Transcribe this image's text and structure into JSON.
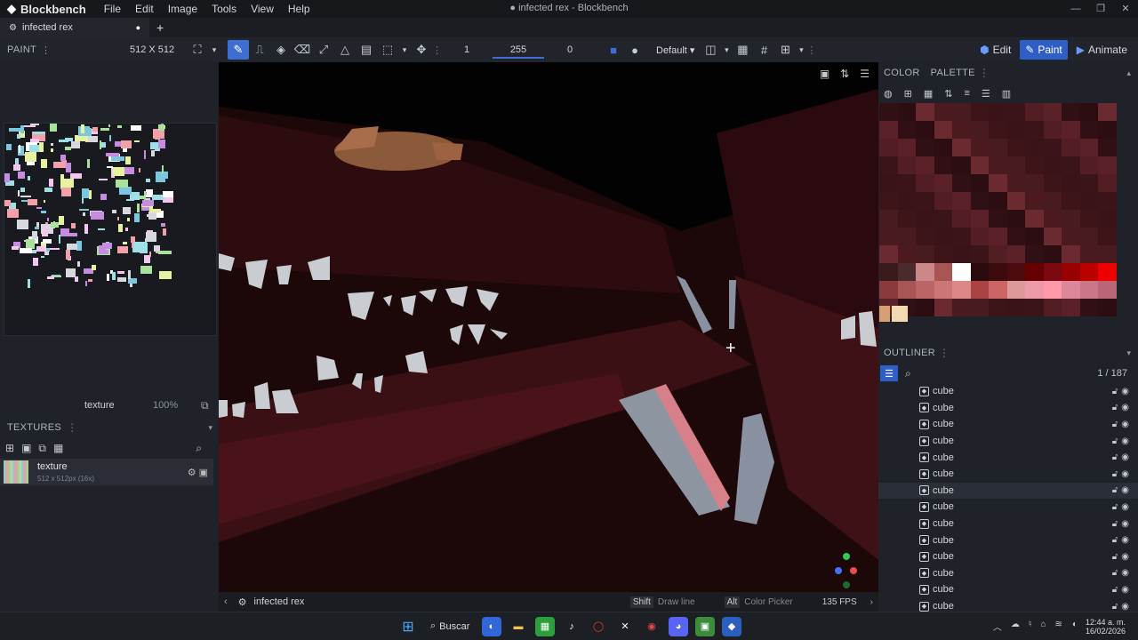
{
  "app": {
    "name": "Blockbench",
    "window_title": "● infected rex - Blockbench",
    "menu": [
      "File",
      "Edit",
      "Image",
      "Tools",
      "View",
      "Help"
    ]
  },
  "tabs": [
    {
      "label": "infected rex"
    }
  ],
  "toolbar": {
    "brush_size": "1",
    "opacity": "255",
    "softness": "0",
    "blend_mode": "Default"
  },
  "modes": {
    "edit": "Edit",
    "paint": "Paint",
    "animate": "Animate"
  },
  "left": {
    "panel_title": "PAINT",
    "resolution": "512 X 512",
    "texture_name": "texture",
    "zoom": "100%",
    "textures_title": "TEXTURES",
    "texture_item": {
      "name": "texture",
      "size": "512 x 512px (16x)"
    }
  },
  "viewport": {
    "model_name": "infected rex",
    "hint_shift_key": "Shift",
    "hint_shift_action": "Draw line",
    "hint_alt_key": "Alt",
    "hint_alt_action": "Color Picker",
    "fps": "135 FPS"
  },
  "right": {
    "color_tab": "COLOR",
    "palette_tab": "PALETTE",
    "outliner_title": "OUTLINER",
    "outliner_count": "1 / 187",
    "items": [
      "cube",
      "cube",
      "cube",
      "cube",
      "cube",
      "cube",
      "cube",
      "cube",
      "cube",
      "cube",
      "cube",
      "cube",
      "cube",
      "cube"
    ],
    "selected_index": 6
  },
  "palette_colors": [
    "#301015",
    "#3a1418",
    "#471b20",
    "#2c0e12",
    "#521e24",
    "#3d1519",
    "#6a2a30",
    "#5a2228",
    "#3a1318",
    "#4a1a1f"
  ],
  "taskbar": {
    "search": "Buscar",
    "time": "12:44 a. m.",
    "date": "16/02/2026"
  },
  "colors": {
    "accent": "#2e5fc6",
    "flesh": "#4a1219",
    "teeth": "#c9ccd0"
  }
}
